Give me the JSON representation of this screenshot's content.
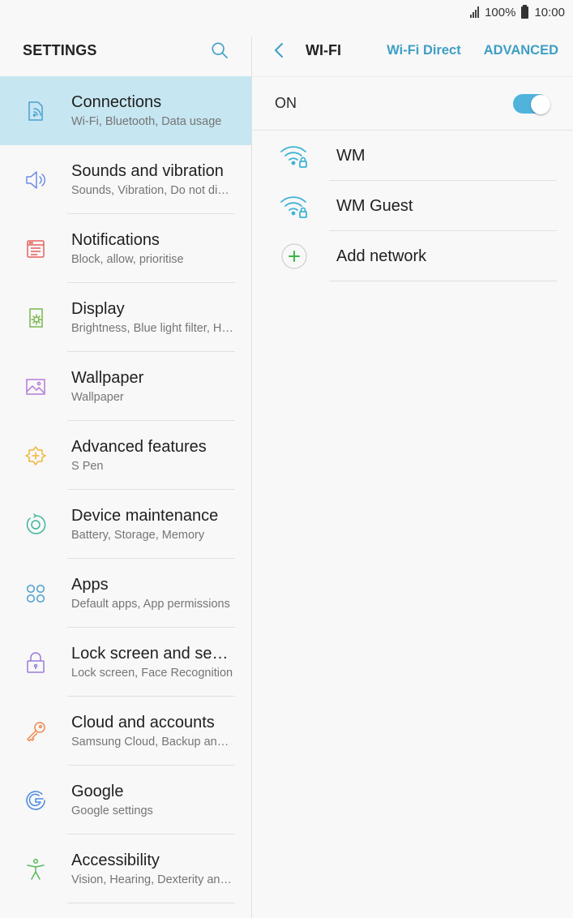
{
  "status_bar": {
    "battery": "100%",
    "time": "10:00"
  },
  "left": {
    "title": "SETTINGS",
    "items": [
      {
        "label": "Connections",
        "sub": "Wi-Fi, Bluetooth, Data usage",
        "icon": "connections-icon",
        "active": true
      },
      {
        "label": "Sounds and vibration",
        "sub": "Sounds, Vibration, Do not disturb",
        "icon": "speaker-icon"
      },
      {
        "label": "Notifications",
        "sub": "Block, allow, prioritise",
        "icon": "notifications-icon"
      },
      {
        "label": "Display",
        "sub": "Brightness, Blue light filter, Home screen",
        "icon": "display-icon"
      },
      {
        "label": "Wallpaper",
        "sub": "Wallpaper",
        "icon": "wallpaper-icon"
      },
      {
        "label": "Advanced features",
        "sub": "S Pen",
        "icon": "advanced-features-icon"
      },
      {
        "label": "Device maintenance",
        "sub": "Battery, Storage, Memory",
        "icon": "device-maintenance-icon"
      },
      {
        "label": "Apps",
        "sub": "Default apps, App permissions",
        "icon": "apps-icon"
      },
      {
        "label": "Lock screen and security",
        "sub": "Lock screen, Face Recognition",
        "icon": "lock-icon"
      },
      {
        "label": "Cloud and accounts",
        "sub": "Samsung Cloud, Backup and restore",
        "icon": "key-icon"
      },
      {
        "label": "Google",
        "sub": "Google settings",
        "icon": "google-icon"
      },
      {
        "label": "Accessibility",
        "sub": "Vision, Hearing, Dexterity and interaction",
        "icon": "accessibility-icon"
      }
    ]
  },
  "right": {
    "title": "WI-FI",
    "wifi_direct": "Wi-Fi Direct",
    "advanced": "ADVANCED",
    "on_label": "ON",
    "toggle_on": true,
    "networks": [
      {
        "label": "WM",
        "icon": "wifi-lock-icon"
      },
      {
        "label": "WM Guest",
        "icon": "wifi-lock-icon"
      },
      {
        "label": "Add network",
        "icon": "add-icon"
      }
    ]
  },
  "colors": {
    "accent": "#3e9fc5",
    "active_row": "#c6e6f1",
    "toggle": "#4fb3dc"
  }
}
